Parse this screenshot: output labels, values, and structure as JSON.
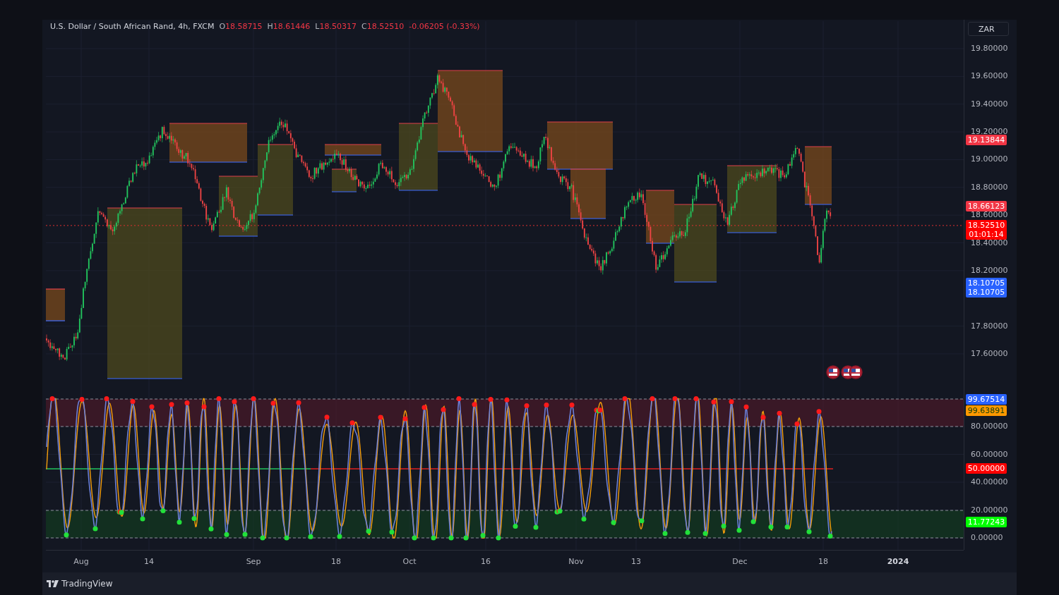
{
  "legend": {
    "symbol": "U.S. Dollar / South African Rand, 4h, FXCM",
    "values": [
      {
        "key": "O",
        "value": "18.58715"
      },
      {
        "key": "H",
        "value": "18.61446"
      },
      {
        "key": "L",
        "value": "18.50317"
      },
      {
        "key": "C",
        "value": "18.52510"
      }
    ],
    "change": "-0.06205 (-0.33%)"
  },
  "price_axis": {
    "currency": "ZAR",
    "ticks": [
      "19.80000",
      "19.60000",
      "19.40000",
      "19.20000",
      "19.00000",
      "18.80000",
      "18.60000",
      "18.40000",
      "18.20000",
      "17.80000",
      "17.60000"
    ],
    "labels": [
      {
        "lines": [
          "19.13844"
        ],
        "color": "#f23645"
      },
      {
        "lines": [
          "18.66123"
        ],
        "color": "#f23645"
      },
      {
        "lines": [
          "18.52510",
          "01:01:14"
        ],
        "color": "#ff0000"
      },
      {
        "lines": [
          "18.10705",
          "18.10705"
        ],
        "color": "#2962ff"
      }
    ]
  },
  "oscillator_axis": {
    "ticks": [
      "80.00000",
      "60.00000",
      "40.00000",
      "20.00000",
      "0.00000"
    ],
    "labels": [
      {
        "text": "99.67514",
        "color": "#2962ff"
      },
      {
        "text": "99.63891",
        "color": "#ff9800"
      },
      {
        "text": "50.00000",
        "color": "#ff0000"
      },
      {
        "text": "11.77243",
        "color": "#00ff00"
      }
    ]
  },
  "time_axis": {
    "labels": [
      {
        "text": "Aug",
        "kind": "month"
      },
      {
        "text": "14",
        "kind": "day"
      },
      {
        "text": "Sep",
        "kind": "month"
      },
      {
        "text": "18",
        "kind": "day"
      },
      {
        "text": "Oct",
        "kind": "month"
      },
      {
        "text": "16",
        "kind": "day"
      },
      {
        "text": "Nov",
        "kind": "month"
      },
      {
        "text": "13",
        "kind": "day"
      },
      {
        "text": "Dec",
        "kind": "month"
      },
      {
        "text": "18",
        "kind": "day"
      },
      {
        "text": "2024",
        "kind": "year"
      }
    ]
  },
  "footer": {
    "brand": "TradingView"
  }
}
